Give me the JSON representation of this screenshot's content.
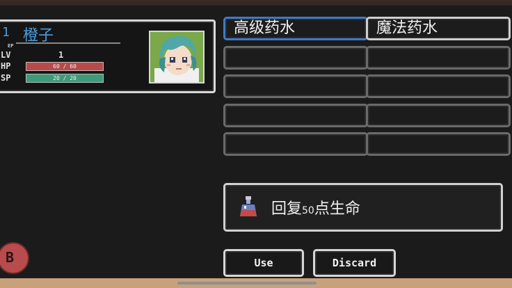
{
  "character": {
    "index": "1",
    "name": "橙子",
    "ep_label": "EP",
    "lv_label": "LV",
    "lv_value": "1",
    "hp_label": "HP",
    "hp_text": "60 / 60",
    "hp_fraction": 1.0,
    "sp_label": "SP",
    "sp_text": "20 / 20",
    "sp_fraction": 1.0,
    "hp_color": "#b94a4a",
    "sp_color": "#3d9a7a"
  },
  "inventory": {
    "slots": [
      {
        "label": "高级药水",
        "state": "selected"
      },
      {
        "label": "魔法药水",
        "state": "filled"
      },
      {
        "label": "",
        "state": "empty"
      },
      {
        "label": "",
        "state": "empty"
      },
      {
        "label": "",
        "state": "empty"
      },
      {
        "label": "",
        "state": "empty"
      },
      {
        "label": "",
        "state": "empty"
      },
      {
        "label": "",
        "state": "empty"
      },
      {
        "label": "",
        "state": "empty"
      },
      {
        "label": "",
        "state": "empty"
      }
    ]
  },
  "description": {
    "pre": "回复",
    "amount": "50",
    "post": "点生命",
    "icon": "potion-icon"
  },
  "buttons": {
    "use_label": "Use",
    "discard_label": "Discard",
    "b_label": "B"
  }
}
